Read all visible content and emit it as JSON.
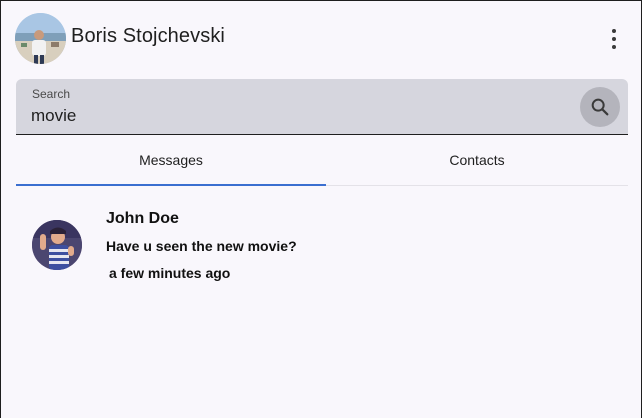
{
  "header": {
    "user_name": "Boris Stojchevski",
    "avatar_icon": "user-avatar-photo",
    "menu_icon": "kebab-menu-icon"
  },
  "search": {
    "label": "Search",
    "value": "movie",
    "icon": "search-icon"
  },
  "tabs": [
    {
      "label": "Messages",
      "active": true
    },
    {
      "label": "Contacts",
      "active": false
    }
  ],
  "conversations": [
    {
      "name": "John Doe",
      "last_message": "Have u seen the new movie?",
      "time": "a few minutes ago"
    }
  ],
  "colors": {
    "accent": "#3b6fd0",
    "search_bg": "#d6d6de",
    "background": "#f9f7fc"
  }
}
